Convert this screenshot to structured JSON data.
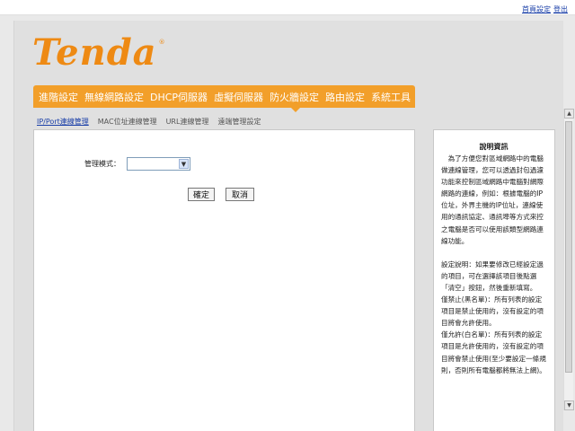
{
  "top_links": {
    "home": "首頁設定",
    "logout": "登出"
  },
  "logo": {
    "text": "Tenda",
    "reg_mark": "®"
  },
  "nav": {
    "items": [
      "進階設定",
      "無線網路設定",
      "DHCP伺服器",
      "虛擬伺服器",
      "防火牆設定",
      "路由設定",
      "系統工具"
    ],
    "active": "防火牆設定"
  },
  "subnav": {
    "items": [
      "IP/Port連線管理",
      "MAC位址連線管理",
      "URL連線管理",
      "遠端管理設定"
    ],
    "active": "IP/Port連線管理"
  },
  "form": {
    "mode_label": "管理模式：",
    "mode_value": "",
    "ok_label": "確定",
    "cancel_label": "取消"
  },
  "help": {
    "title": "說明資訊",
    "paragraph1": "　為了方便您對區域網路中的電腦做連線管理，您可以透過封包過濾功能來控制區域網路中電腦對網際網路的連線，例如：根據電腦的IP位址，外界主機的IP位址，連線使用的通訊協定、通訊埠等方式來控之電腦是否可以使用該類型網路連線功能。",
    "paragraph2": "設定說明：如果要修改已經設定過的項目，可在選擇該項目後點選「清空」按鈕，然後重新填寫。",
    "paragraph3": "僅禁止(黑名單)：所有列表的設定項目是禁止使用的，沒有設定的項目將會允許使用。",
    "paragraph4": "僅允許(白名單)：所有列表的設定項目是允許使用的，沒有設定的項目將會禁止使用(至少要設定一條規則，否則所有電腦都將無法上網)。"
  },
  "colors": {
    "accent": "#f29f2a",
    "logo": "#ee8a14",
    "link": "#1a3fa8"
  },
  "icons": {
    "select_arrow": "chevron-down-icon",
    "scroll_up": "arrow-up-icon",
    "scroll_down": "arrow-down-icon"
  }
}
